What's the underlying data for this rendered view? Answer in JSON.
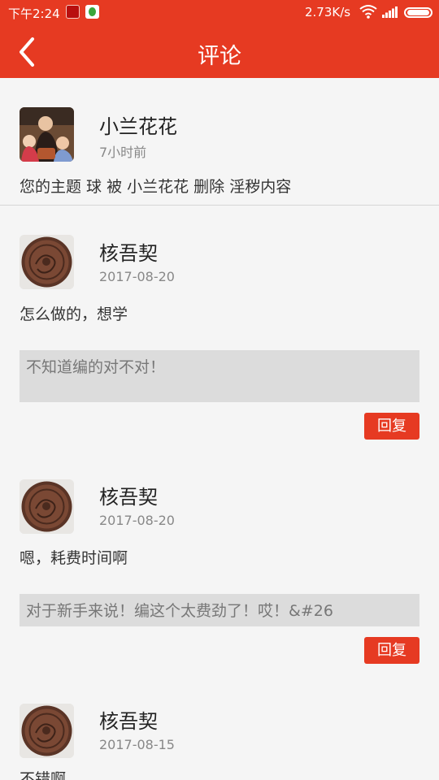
{
  "status_bar": {
    "time": "下午2:24",
    "net_speed": "2.73K/s",
    "icons": [
      "app-red-icon",
      "app-green-icon",
      "wifi-icon",
      "signal-icon",
      "battery-icon"
    ]
  },
  "header": {
    "title": "评论",
    "back_icon": "chevron-left-icon",
    "color": "#e63a22"
  },
  "notice": {
    "user": "小兰花花",
    "time": "7小时前",
    "message": "您的主题 球 被 小兰花花 删除 淫秽内容"
  },
  "comments": [
    {
      "user": "核吾契",
      "date": "2017-08-20",
      "text": "怎么做的，想学",
      "quote": "不知道编的对不对！",
      "reply_label": "回复"
    },
    {
      "user": "核吾契",
      "date": "2017-08-20",
      "text": "嗯，耗费时间啊",
      "quote": "对于新手来说！编这个太费劲了！哎！&#26",
      "reply_label": "回复"
    },
    {
      "user": "核吾契",
      "date": "2017-08-15",
      "text": "不错啊"
    }
  ]
}
